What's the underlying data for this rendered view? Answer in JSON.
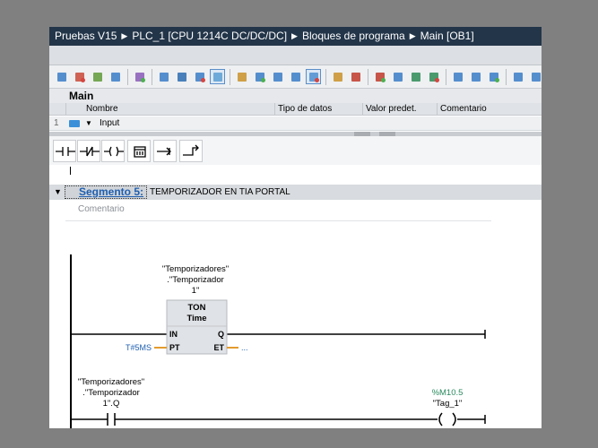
{
  "breadcrumb": [
    "Pruebas V15",
    "PLC_1 [CPU 1214C DC/DC/DC]",
    "Bloques de programa",
    "Main [OB1]"
  ],
  "block_title": "Main",
  "interface": {
    "columns": [
      "Nombre",
      "Tipo de datos",
      "Valor predet.",
      "Comentario"
    ],
    "row": {
      "number": "1",
      "name": "Input"
    }
  },
  "toolbar_icons": [
    "insert-network-icon",
    "delete-network-icon",
    "insert-row-icon",
    "add-row-icon",
    "absolute-operands-icon",
    "favorites-icon",
    "list-view-icon",
    "display-icon",
    "comments-toggle-icon",
    "show-network-icon",
    "open-networks-icon",
    "close-networks-icon",
    "local-tags-icon",
    "show-all-icon",
    "monitor-icon",
    "breakpoint-icon",
    "remove-breakpoint-icon",
    "navigate-icon",
    "download-icon",
    "upload-icon",
    "go-to-icon",
    "previous-icon",
    "next-icon",
    "monitoring-on-icon",
    "monitoring-off-icon",
    "transfer-icon"
  ],
  "lad_instructions": [
    "no-contact-icon",
    "nc-contact-icon",
    "output-coil-icon",
    "empty-box-icon",
    "open-branch-icon",
    "close-branch-icon"
  ],
  "segment": {
    "title": "Segmento 5:",
    "description": "TEMPORIZADOR EN TIA PORTAL",
    "comment": "Comentario"
  },
  "timer": {
    "instance_line1": "\"Temporizadores\"",
    "instance_line2": ".\"Temporizador",
    "instance_line3": "1\"",
    "type": "TON",
    "subtype": "Time",
    "pin_in": "IN",
    "pin_pt": "PT",
    "pin_q": "Q",
    "pin_et": "ET",
    "pt_value": "T#5MS",
    "et_value": "..."
  },
  "contact": {
    "line1": "\"Temporizadores\"",
    "line2": ".\"Temporizador",
    "line3": "1\".Q"
  },
  "coil": {
    "address": "%M10.5",
    "tag": "\"Tag_1\""
  },
  "colors": {
    "title_bar": "#233549",
    "segment_title": "#1f5fb0",
    "box_fill": "#dfe2e6",
    "pin_orange": "#e39b2e",
    "address_green": "#2a8a5e"
  }
}
